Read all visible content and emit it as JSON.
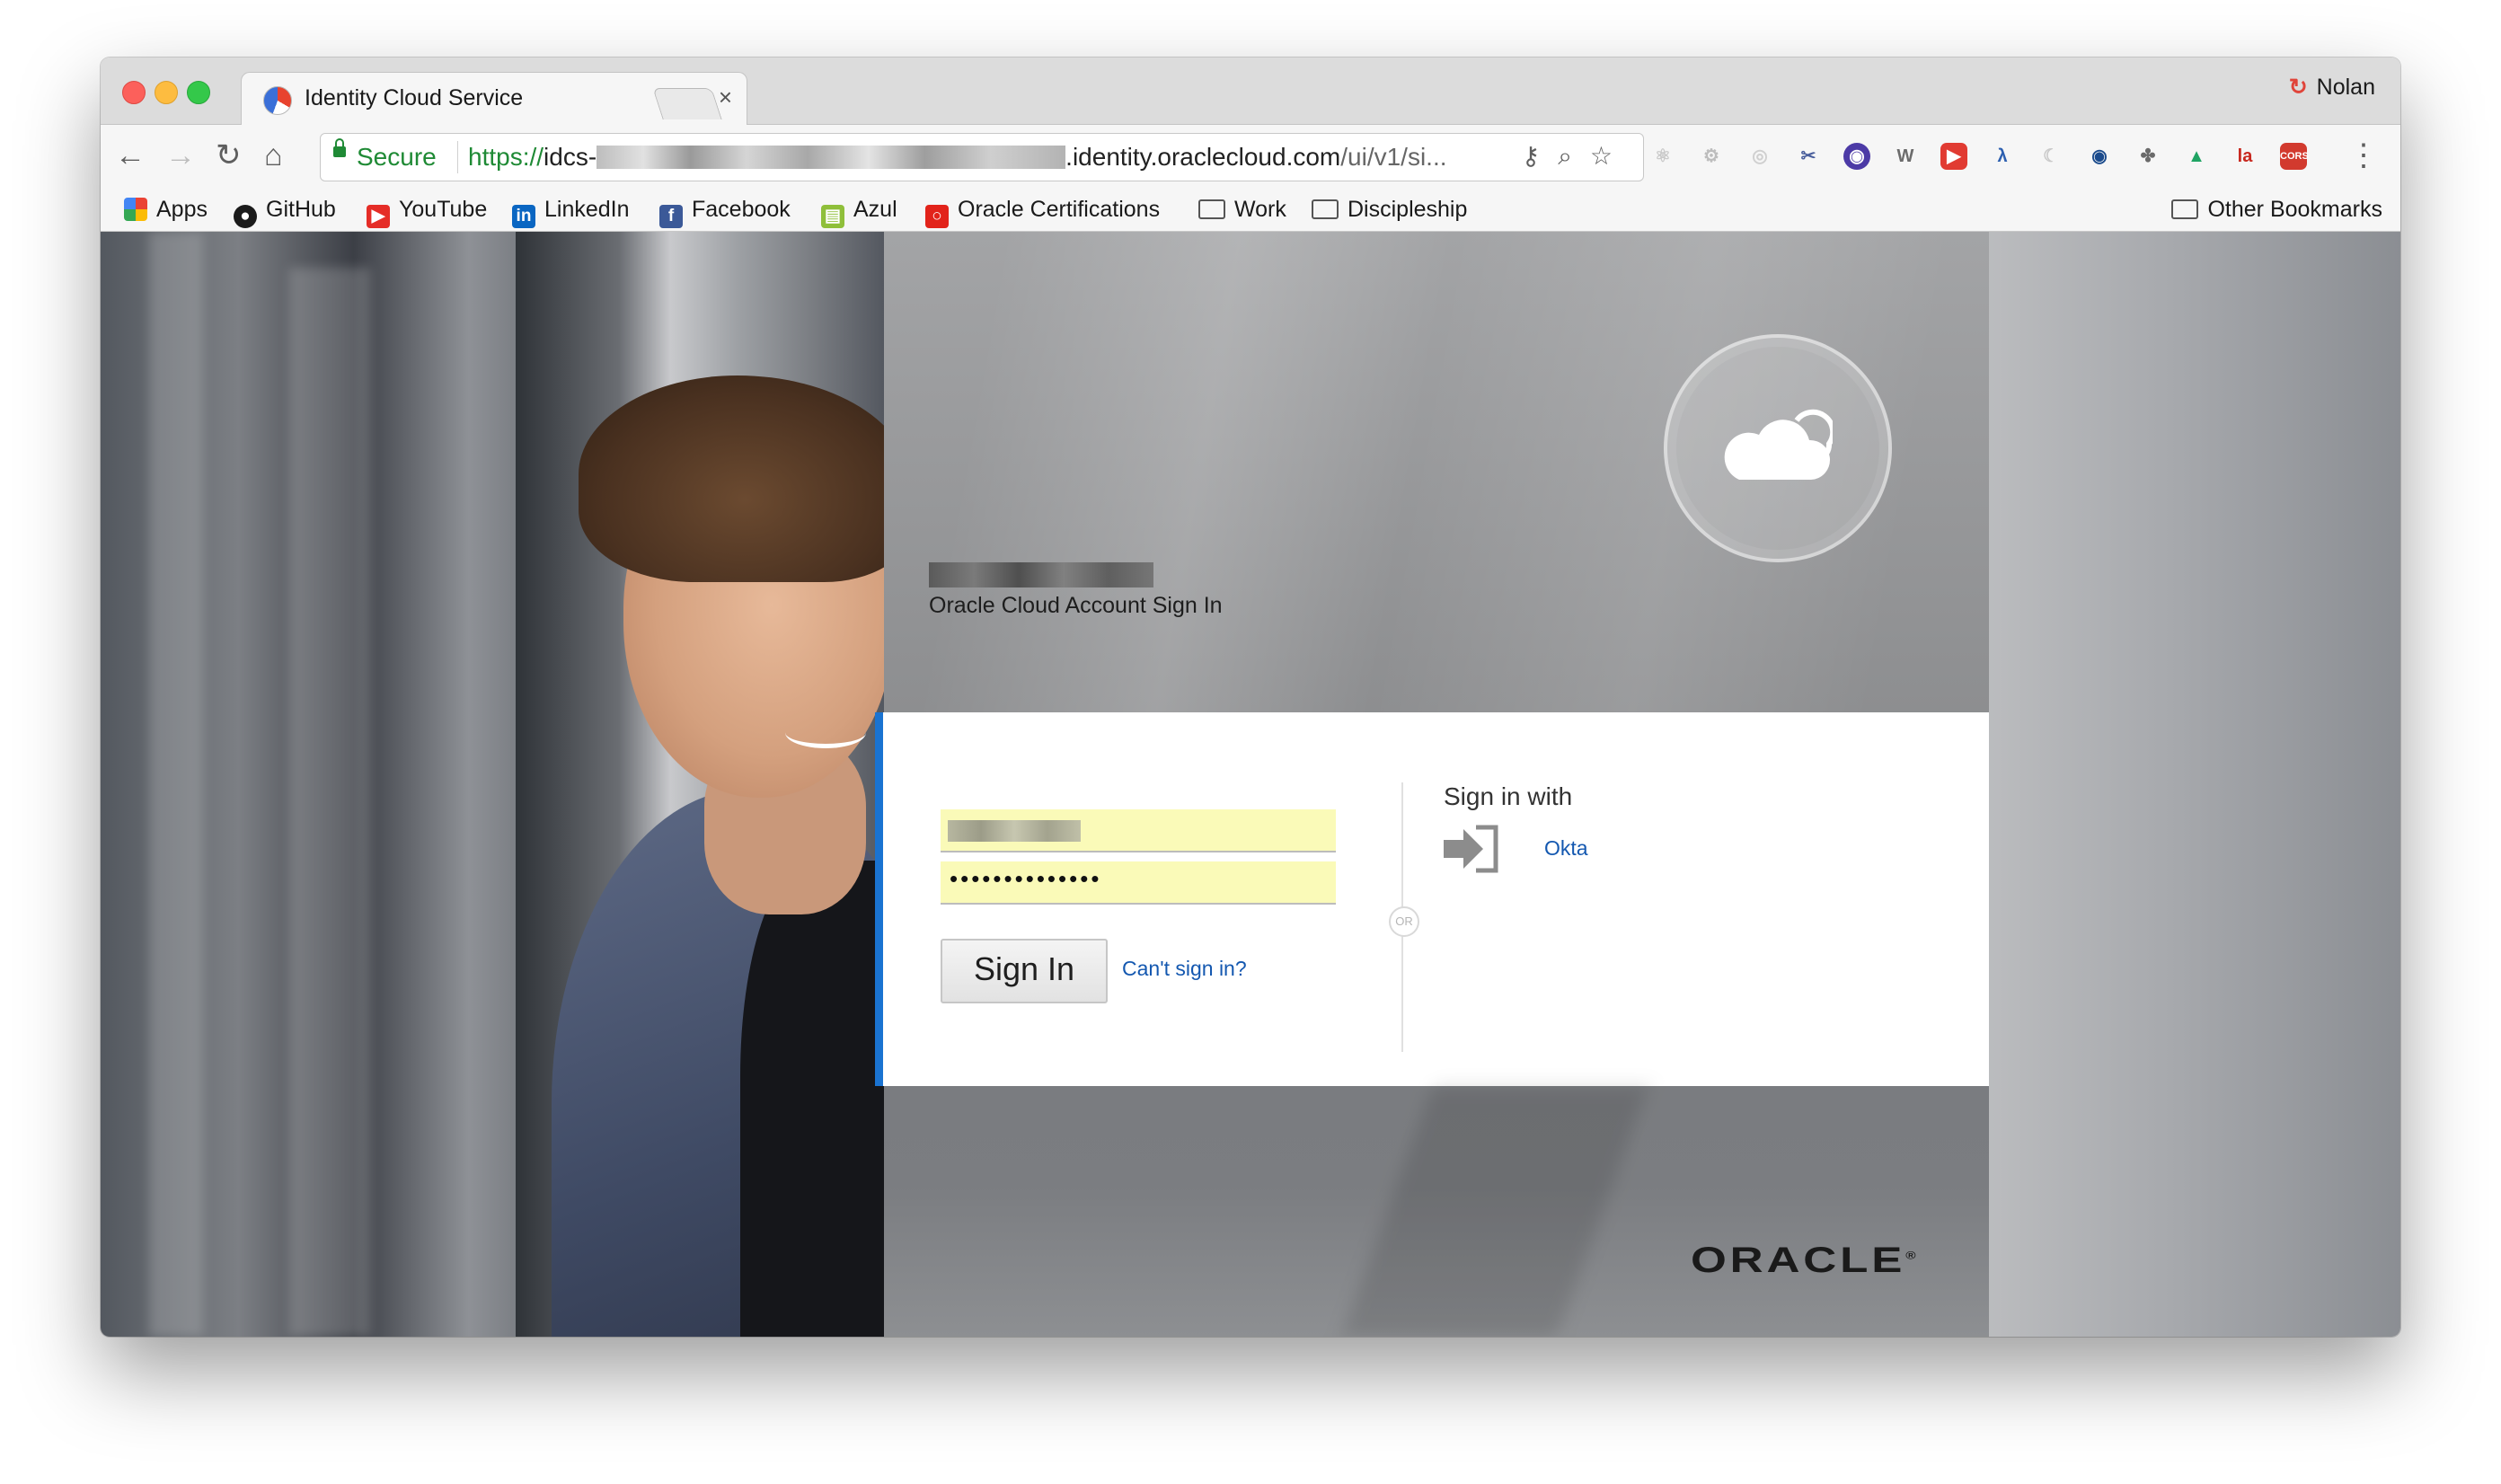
{
  "browser": {
    "tab_title": "Identity Cloud Service",
    "tab_close": "×",
    "profile_name": "Nolan",
    "secure_label": "Secure",
    "url_scheme": "https://",
    "url_prefix": "idcs-",
    "url_host_suffix": ".identity.oraclecloud.com",
    "url_path": "/ui/v1/si...",
    "bookmarks": [
      {
        "label": "Apps",
        "icon": "apps-grid-icon"
      },
      {
        "label": "GitHub",
        "icon": "github-icon"
      },
      {
        "label": "YouTube",
        "icon": "youtube-icon"
      },
      {
        "label": "LinkedIn",
        "icon": "linkedin-icon"
      },
      {
        "label": "Facebook",
        "icon": "facebook-icon"
      },
      {
        "label": "Azul",
        "icon": "azul-icon"
      },
      {
        "label": "Oracle Certifications",
        "icon": "oracle-icon"
      },
      {
        "label": "Work",
        "icon": "folder-icon"
      },
      {
        "label": "Discipleship",
        "icon": "folder-icon"
      }
    ],
    "other_bookmarks": "Other Bookmarks",
    "extension_icons": [
      "react-icon",
      "settings-icon",
      "circle-icon",
      "scissors-icon",
      "globe-icon",
      "w-icon",
      "record-icon",
      "lambda-icon",
      "moon-icon",
      "eye-icon",
      "puzzle-icon",
      "drive-icon",
      "la-icon",
      "cors-icon"
    ]
  },
  "page": {
    "hero_title": "Oracle Cloud Account Sign In",
    "username_value": "",
    "password_value": "••••••••••••••",
    "signin_button": "Sign In",
    "cant_signin": "Can't sign in?",
    "or_label": "OR",
    "signin_with": "Sign in with",
    "idp_okta": "Okta",
    "brand": "ORACLE",
    "brand_mark": "®"
  },
  "colors": {
    "accent": "#1a73d1",
    "link": "#1458b0",
    "autofill": "#fafab8",
    "secure_green": "#1f8a35"
  }
}
